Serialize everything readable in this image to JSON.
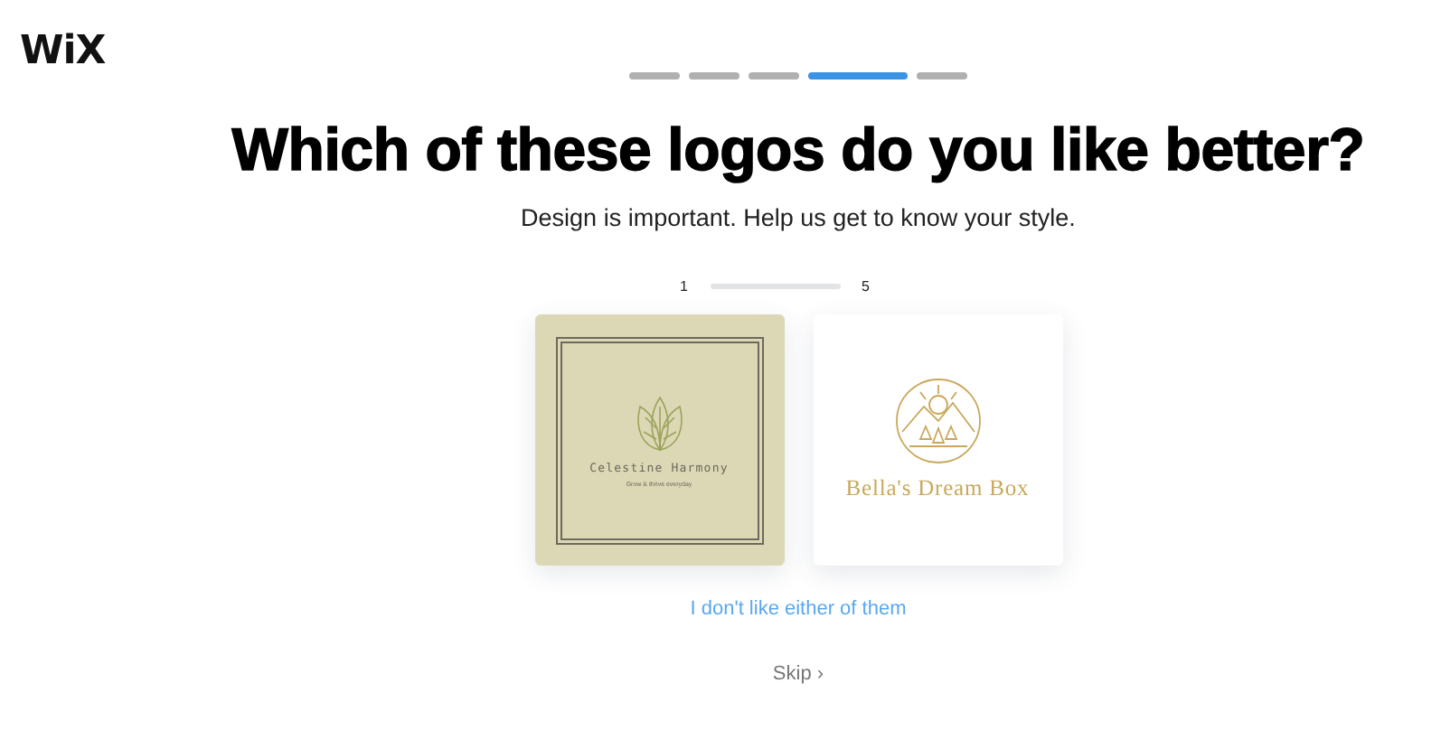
{
  "brand": {
    "logo": "WiX"
  },
  "steps": [
    {
      "selected": false
    },
    {
      "selected": false
    },
    {
      "selected": false
    },
    {
      "selected": true
    },
    {
      "selected": false
    }
  ],
  "title": "Which of these logos do you like better?",
  "subtitle": "Design is important. Help us get to know your style.",
  "scale": {
    "min": "1",
    "max": "5"
  },
  "logos": [
    {
      "kind": "framed",
      "name": "Celestine Harmony",
      "tagline": "Grow & thrive everyday"
    },
    {
      "kind": "badge",
      "name": "Bella's Dream Box"
    }
  ],
  "neither_link": "I don't like either of them",
  "skip": {
    "label": "Skip",
    "icon": "›"
  }
}
